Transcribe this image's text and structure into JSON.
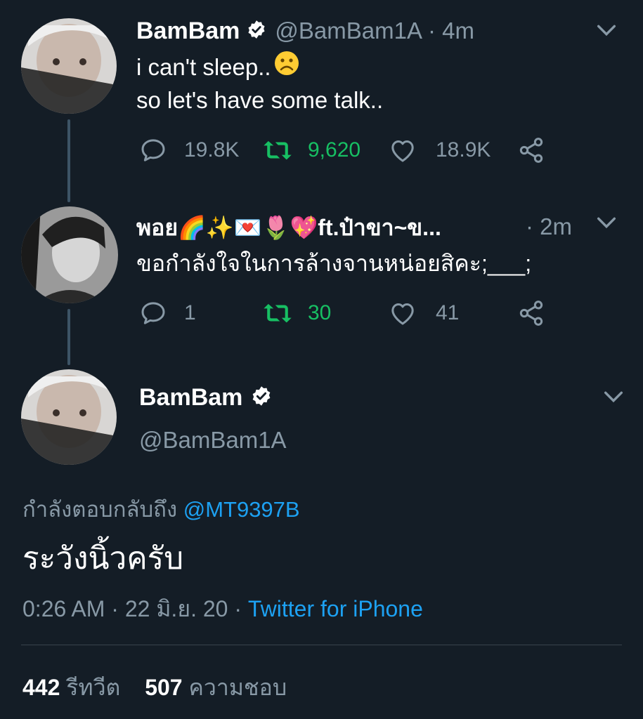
{
  "tweet1": {
    "name": "BamBam",
    "handle": "@BamBam1A",
    "time": "· 4m",
    "line1": "i can't sleep..",
    "line1_emoji": "☹",
    "line2": "so let's have some talk..",
    "replies": "19.8K",
    "retweets": "9,620",
    "likes": "18.9K"
  },
  "tweet2": {
    "name": "พอย🌈✨💌🌷💖ft.ป๋าขา~ข...",
    "time": "· 2m",
    "text": "ขอกำลังใจในการล้างจานหน่อยสิคะ;___;",
    "replies": "1",
    "retweets": "30",
    "likes": "41"
  },
  "main": {
    "name": "BamBam",
    "handle": "@BamBam1A",
    "replying_label": "กำลังตอบกลับถึง",
    "replying_to": "@MT9397B",
    "text": "ระวังนิ้วครับ",
    "timestamp": "0:26 AM · 22 มิ.ย. 20 ·",
    "source": "Twitter for iPhone",
    "retweet_count": "442",
    "retweet_label": "รีทวีต",
    "like_count": "507",
    "like_label": "ความชอบ"
  },
  "colors": {
    "background": "#141d26",
    "muted": "#8899a6",
    "link": "#1da1f2",
    "retweet": "#17bf63"
  },
  "icons": [
    "verified-badge-icon",
    "chevron-down-icon",
    "reply-icon",
    "retweet-icon",
    "like-icon",
    "share-icon",
    "frown-emoji"
  ]
}
